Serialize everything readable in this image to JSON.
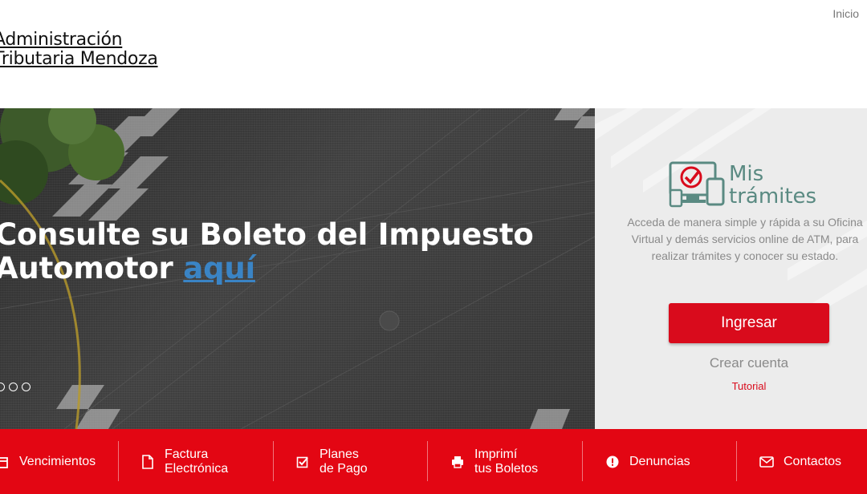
{
  "header": {
    "top_link": "Inicio",
    "logo_line1": "Administración",
    "logo_line2": "Tributaria Mendoza"
  },
  "hero": {
    "title_main": "Consulte su Boleto del Impuesto Automotor ",
    "title_highlight": "aquí",
    "slide_count": 3
  },
  "panel": {
    "brand_line1": "Mis",
    "brand_line2": "trámites",
    "description": "Acceda de manera simple y rápida a su Oficina Virtual y demás servicios online de ATM, para realizar trámites y conocer su estado.",
    "login_button": "Ingresar",
    "create_account": "Crear cuenta",
    "tutorial": "Tutorial"
  },
  "nav": {
    "items": [
      {
        "line1": "Vencimientos",
        "line2": "",
        "icon": "calendar-icon"
      },
      {
        "line1": "Factura",
        "line2": "Electrónica",
        "icon": "document-icon"
      },
      {
        "line1": "Planes",
        "line2": "de Pago",
        "icon": "checkbox-icon"
      },
      {
        "line1": "Imprimí",
        "line2": "tus Boletos",
        "icon": "printer-icon"
      },
      {
        "line1": "Denuncias",
        "line2": "",
        "icon": "alert-icon"
      },
      {
        "line1": "Contactos",
        "line2": "",
        "icon": "envelope-icon"
      }
    ]
  },
  "colors": {
    "brand_red": "#e30613",
    "button_red": "#d90b1c",
    "link_blue": "#3a84c5",
    "mis_tramites_green": "#5a8a82"
  }
}
